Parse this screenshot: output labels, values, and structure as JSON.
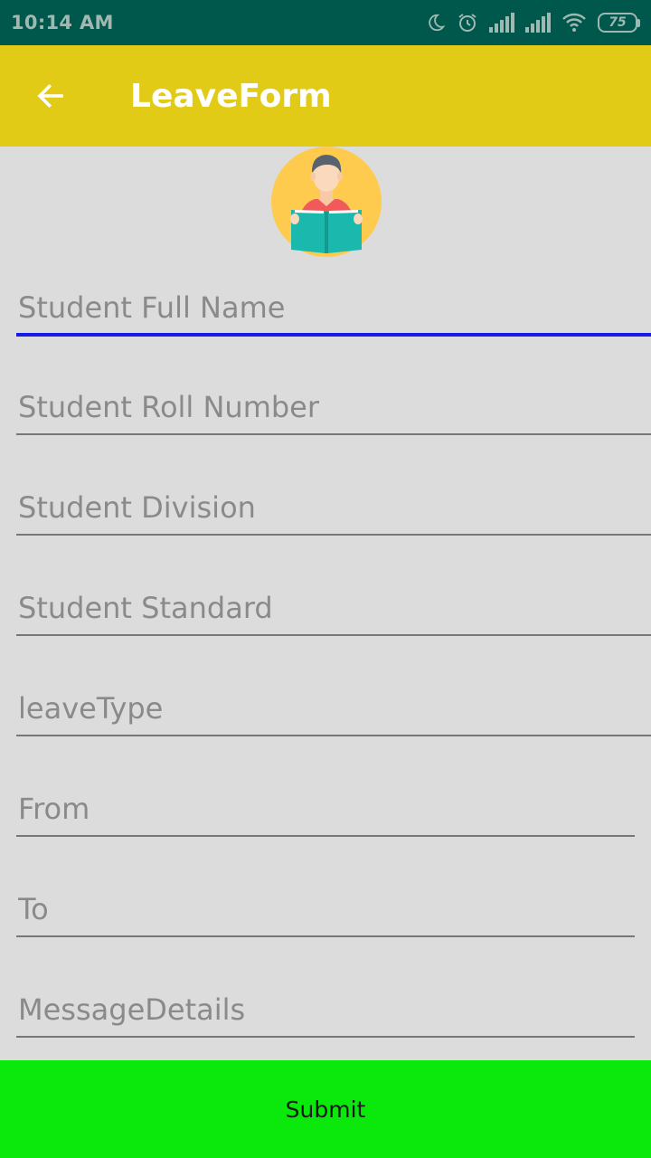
{
  "status_bar": {
    "time": "10:14 AM",
    "battery": "75",
    "icons": [
      "moon-icon",
      "alarm-icon",
      "signal-icon",
      "signal-icon",
      "wifi-icon",
      "battery-icon"
    ]
  },
  "app_bar": {
    "title": "LeaveForm",
    "back_icon": "arrow-left-icon",
    "color": "#e2cb16"
  },
  "avatar": {
    "icon": "student-reading-icon"
  },
  "form": {
    "fields": [
      {
        "placeholder": "Student Full Name",
        "value": ""
      },
      {
        "placeholder": "Student Roll Number",
        "value": ""
      },
      {
        "placeholder": "Student Division",
        "value": ""
      },
      {
        "placeholder": "Student Standard",
        "value": ""
      },
      {
        "placeholder": "leaveType",
        "value": ""
      },
      {
        "placeholder": "From",
        "value": ""
      },
      {
        "placeholder": "To",
        "value": ""
      },
      {
        "placeholder": "MessageDetails",
        "value": ""
      }
    ]
  },
  "submit": {
    "label": "Submit",
    "color": "#0be80b"
  },
  "colors": {
    "status_bar": "#00574b",
    "background": "#dcdcdc",
    "focus_underline": "#1a1ae6"
  }
}
